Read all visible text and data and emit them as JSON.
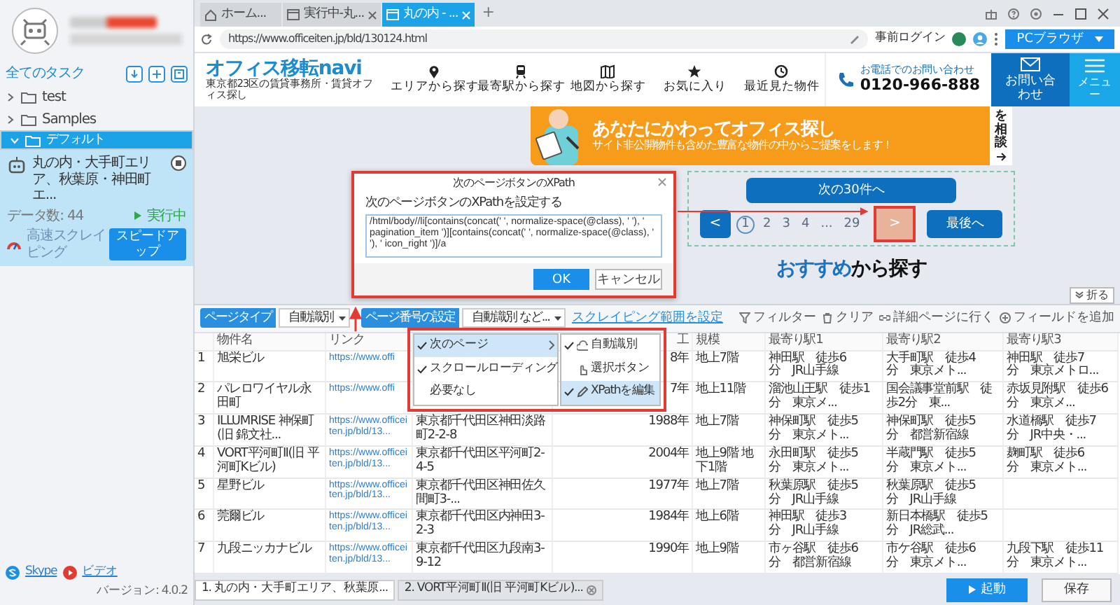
{
  "sidebar": {
    "all_tasks": "全てのタスク",
    "folders": [
      {
        "label": "test",
        "selected": false,
        "expanded": false
      },
      {
        "label": "Samples",
        "selected": false,
        "expanded": false
      },
      {
        "label": "デフォルト",
        "selected": true,
        "expanded": true
      }
    ],
    "task": {
      "title": "丸の内・大手町エリア、秋葉原・神田町エ...",
      "data_count": "データ数: 44",
      "status": "実行中",
      "mode": "高速スクレイピング",
      "speed_button": "スピードアップ"
    },
    "footer": {
      "skype": "Skype",
      "video": "ビデオ",
      "version": "バージョン: 4.0.2"
    }
  },
  "browser": {
    "tabs": [
      {
        "label": "ホーム...",
        "selected": false,
        "kind": "home",
        "closable": false
      },
      {
        "label": "実行中-丸...",
        "selected": false,
        "kind": "page",
        "closable": true
      },
      {
        "label": "丸の内 - ...",
        "selected": true,
        "kind": "page",
        "closable": true
      }
    ],
    "new_tab": "+",
    "url": "https://www.officeiten.jp/bld/130124.html",
    "login": "事前ログイン",
    "browser_mode": "PCブラウザ"
  },
  "site": {
    "logo": "オフィス移転navi",
    "tagline": "東京都23区の賃貸事務所・賃貸オフィス探し",
    "nav": [
      {
        "label": "エリアから探す",
        "kind": "pin"
      },
      {
        "label": "最寄駅から探す",
        "kind": "train"
      },
      {
        "label": "地図から探す",
        "kind": "map"
      },
      {
        "label": "お気に入り",
        "kind": "star"
      },
      {
        "label": "最近見た物件",
        "kind": "clock"
      }
    ],
    "phone_caption": "お電話でのお問い合わせ",
    "phone": "0120-966-888",
    "contact": "お問い合わせ",
    "menu": "メニュー",
    "banner": {
      "headline": "あなたにかわってオフィス探し",
      "sub": "サイト非公開物件も含めた豊富な物件の中からご提案をします！",
      "side": "を相談"
    },
    "next_30": "次の30件へ",
    "prev": "<",
    "pages": [
      {
        "label": "1",
        "selected": true
      },
      {
        "label": "2",
        "selected": false
      },
      {
        "label": "3",
        "selected": false
      },
      {
        "label": "4",
        "selected": false
      },
      {
        "label": "...",
        "selected": false
      },
      {
        "label": "29",
        "selected": false
      }
    ],
    "next": {
      "label": ">",
      "highlighted": true
    },
    "last": "最後へ",
    "heading": {
      "highlight": "おすすめ",
      "rest": "から探す"
    }
  },
  "dialog": {
    "title": "次のページボタンのXPath",
    "label": "次のページボタンのXPathを設定する",
    "xpath": "/html/body//li[contains(concat(' ', normalize-space(@class), ' '), ' pagination_item ')][contains(concat(' ', normalize-space(@class), ' '), ' icon_right ')]/a",
    "ok": "OK",
    "cancel": "キャンセル"
  },
  "panel": {
    "page_type_label": "ページタイプ",
    "page_type": "自動識別",
    "page_number_label": "ページ番号の設定",
    "page_number": "自動識別 など...",
    "scope_link": "スクレイピング範囲を設定",
    "tools": [
      {
        "label": "フィルター",
        "kind": "filter"
      },
      {
        "label": "クリア",
        "kind": "trash"
      },
      {
        "label": "詳細ページに行く",
        "kind": "link"
      },
      {
        "label": "フィールドを追加",
        "kind": "add"
      }
    ],
    "collapse": "折る",
    "menu": [
      {
        "label": "次のページ",
        "checked": true,
        "selected": true
      },
      {
        "label": "スクロールローディング",
        "checked": true,
        "selected": false
      },
      {
        "label": "必要なし",
        "checked": false,
        "selected": false
      }
    ],
    "submenu": [
      {
        "label": "自動識別",
        "checked": true,
        "selected": false,
        "kind": "auto"
      },
      {
        "label": "選択ボタン",
        "checked": false,
        "selected": false,
        "kind": "hand"
      },
      {
        "label": "XPathを編集",
        "checked": true,
        "selected": true,
        "kind": "pencil"
      }
    ]
  },
  "table": {
    "columns": [
      "物件名",
      "リンク",
      null,
      "工",
      "規模",
      "最寄り駅1",
      "最寄り駅2",
      "最寄り駅3"
    ],
    "rows": [
      {
        "index": "1",
        "cells": [
          "旭栄ビル",
          "https://www.offi",
          null,
          "8年",
          "地上7階",
          "神田駅　徒歩6分　JR山手線",
          "大手町駅　徒歩4分　東京メト...",
          "神田駅　徒歩7分　東京メトロ..."
        ]
      },
      {
        "index": "2",
        "cells": [
          "パレロワイヤル永田町",
          "https://www.offi",
          null,
          "7年",
          "地上11階",
          "溜池山王駅　徒歩1分　東京メ...",
          "国会議事堂前駅　徒歩2分　東...",
          "赤坂見附駅　徒歩6分　東京メ..."
        ]
      },
      {
        "index": "3",
        "cells": [
          "ILLUMRISE 神保町(旧 錦文社...",
          "https://www.officeiten.jp/bld/13...",
          "東京都千代田区神田淡路町2-2-8",
          "1988年",
          "地上7階",
          "神保町駅　徒歩5分　東京メト...",
          "神保町駅　徒歩5分　都営新宿線",
          "水道橋駅　徒歩7分　JR中央・..."
        ]
      },
      {
        "index": "4",
        "cells": [
          "VORT平河町Ⅱ(旧 平河町Kビル)",
          "https://www.officeiten.jp/bld/13...",
          "東京都千代田区平河町2-4-5",
          "2004年",
          "地上9階 地下1階",
          "永田町駅　徒歩5分　東京メト...",
          "半蔵門駅　徒歩5分　東京メト...",
          "麹町駅　徒歩6分　東京メト..."
        ]
      },
      {
        "index": "5",
        "cells": [
          "星野ビル",
          "https://www.officeiten.jp/bld/13...",
          "東京都千代田区神田佐久間町3-...",
          "1977年",
          "地上7階",
          "秋葉原駅　徒歩5分　JR山手線",
          "秋葉原駅　徒歩5分　JR山手線",
          null
        ]
      },
      {
        "index": "6",
        "cells": [
          "莞爾ビル",
          "https://www.officeiten.jp/bld/13...",
          "東京都千代田区内神田3-2-3",
          "1984年",
          "地上6階",
          "神田駅　徒歩3分　JR山手線",
          "新日本橋駅　徒歩5分　JR総武...",
          null
        ]
      },
      {
        "index": "7",
        "cells": [
          "九段ニッカナビル",
          "https://www.officeiten.jp/bld/13...",
          "東京都千代田区九段南3-9-12",
          "1990年",
          "地上9階",
          "市ヶ谷駅　徒歩6分　都営新宿線",
          "市ケ谷駅　徒歩6分　東京メト...",
          "九段下駅　徒歩11分　東京メト..."
        ]
      }
    ]
  },
  "footer": {
    "tabs": [
      {
        "label": "1. 丸の内・大手町エリア、秋葉原...",
        "selected": true,
        "closable": false
      },
      {
        "label": "2. VORT平河町Ⅱ(旧 平河町Kビル)...",
        "selected": false,
        "closable": true
      }
    ],
    "start": "起動",
    "save": "保存"
  }
}
